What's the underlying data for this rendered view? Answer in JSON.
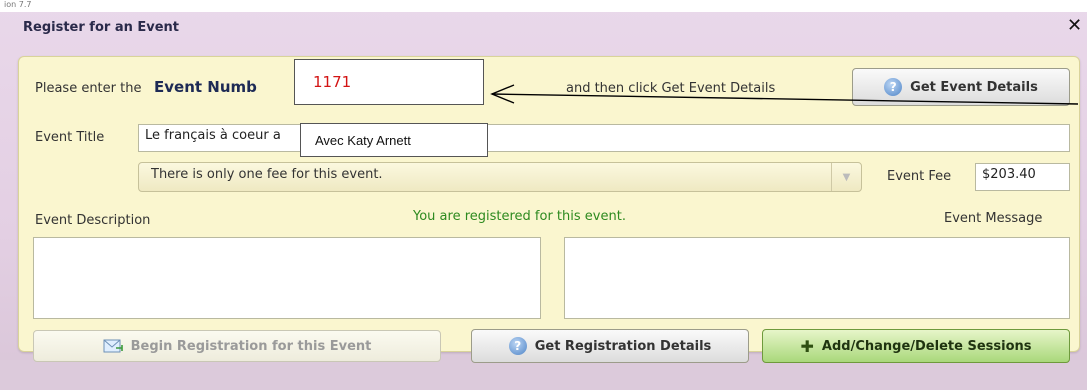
{
  "header": {
    "corner_text": "ion 7.7",
    "title": "Register for an Event",
    "close_symbol": "✕"
  },
  "prompt": {
    "prefix": "Please enter the",
    "event_number_label": "Event Numb",
    "suffix": "and then click Get Event Details"
  },
  "event_number_overlay": {
    "value": "1171"
  },
  "buttons": {
    "get_event_details": "Get Event Details",
    "begin_registration": "Begin Registration for this Event",
    "get_registration_details": "Get Registration Details",
    "add_change_delete_sessions": "Add/Change/Delete Sessions"
  },
  "event_title": {
    "label": "Event Title",
    "value": "Le français à coeur a"
  },
  "event_title_overlay": {
    "text": "Avec Katy Arnett"
  },
  "fee": {
    "dropdown_value": "There is only one fee for this event.",
    "label": "Event Fee",
    "value": "$203.40"
  },
  "description": {
    "label": "Event Description"
  },
  "status": {
    "message": "You are registered for this event.",
    "color": "#2d8a1f"
  },
  "message": {
    "label": "Event Message"
  }
}
